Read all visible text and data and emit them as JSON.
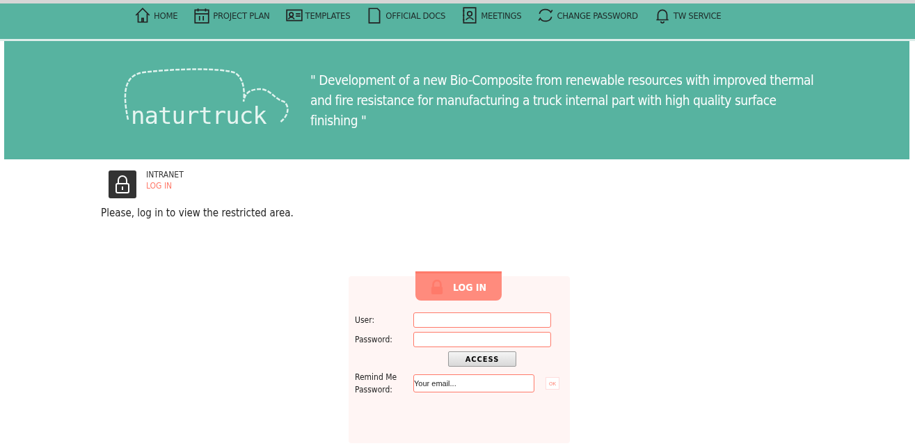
{
  "nav": [
    {
      "label": "HOME"
    },
    {
      "label": "PROJECT PLAN"
    },
    {
      "label": "TEMPLATES"
    },
    {
      "label": "OFFICIAL DOCS"
    },
    {
      "label": "MEETINGS"
    },
    {
      "label": "CHANGE PASSWORD"
    },
    {
      "label": "TW SERVICE"
    }
  ],
  "banner": {
    "logo": "naturtruck",
    "tagline": "\" Development of a new Bio-Composite from renewable resources with improved thermal and fire resistance for manufacturing a truck internal part with high quality surface finishing \""
  },
  "breadcrumb": {
    "section": "INTRANET",
    "page": "LOG IN"
  },
  "message": "Please, log in to view the restricted area.",
  "login": {
    "title": "LOG IN",
    "user_label": "User:",
    "password_label": "Password:",
    "submit": "ACCESS",
    "remind_label": "Remind Me Password:",
    "email_placeholder": "Your email...",
    "ok": "OK"
  }
}
